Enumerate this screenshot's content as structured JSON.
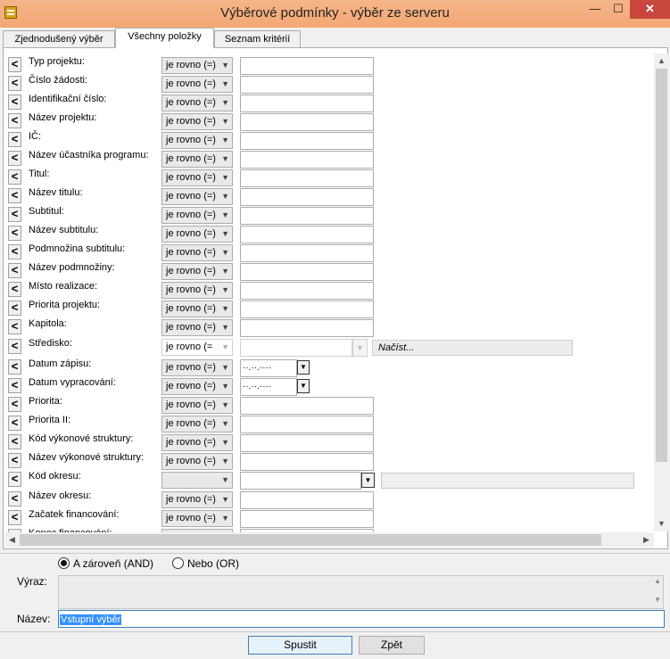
{
  "window": {
    "title": "Výběrové podmínky - výběr ze serveru",
    "minimize_glyph": "—",
    "maximize_glyph": "☐",
    "close_glyph": "✕",
    "icon": "app-icon"
  },
  "tabs": [
    {
      "label": "Zjednodušený výběr",
      "active": false
    },
    {
      "label": "Všechny položky",
      "active": true
    },
    {
      "label": "Seznam kritérií",
      "active": false
    }
  ],
  "criteria": [
    {
      "label": "Typ projektu:",
      "operator": "je rovno (=)",
      "kind": "text"
    },
    {
      "label": "Číslo žádosti:",
      "operator": "je rovno (=)",
      "kind": "text"
    },
    {
      "label": "Identifikační číslo:",
      "operator": "je rovno (=)",
      "kind": "text"
    },
    {
      "label": "Název projektu:",
      "operator": "je rovno (=)",
      "kind": "text"
    },
    {
      "label": "IČ:",
      "operator": "je rovno (=)",
      "kind": "text"
    },
    {
      "label": "Název účastníka programu:",
      "operator": "je rovno (=)",
      "kind": "text"
    },
    {
      "label": "Titul:",
      "operator": "je rovno (=)",
      "kind": "text"
    },
    {
      "label": "Název titulu:",
      "operator": "je rovno (=)",
      "kind": "text"
    },
    {
      "label": "Subtitul:",
      "operator": "je rovno (=)",
      "kind": "text"
    },
    {
      "label": "Název subtitulu:",
      "operator": "je rovno (=)",
      "kind": "text"
    },
    {
      "label": "Podmnožina subtitulu:",
      "operator": "je rovno (=)",
      "kind": "text"
    },
    {
      "label": "Název podmnožiny:",
      "operator": "je rovno (=)",
      "kind": "text"
    },
    {
      "label": "Místo realizace:",
      "operator": "je rovno (=)",
      "kind": "text"
    },
    {
      "label": "Priorita projektu:",
      "operator": "je rovno (=)",
      "kind": "text"
    },
    {
      "label": "Kapitola:",
      "operator": "je rovno (=)",
      "kind": "text"
    },
    {
      "label": "Středisko:",
      "operator": "je rovno (=",
      "kind": "lookup",
      "load_label": "Načíst..."
    },
    {
      "label": "Datum zápisu:",
      "operator": "je rovno (=)",
      "kind": "date",
      "value": "··.··.····"
    },
    {
      "label": "Datum vypracování:",
      "operator": "je rovno (=)",
      "kind": "date",
      "value": "··.··.····"
    },
    {
      "label": "Priorita:",
      "operator": "je rovno (=)",
      "kind": "text"
    },
    {
      "label": "Priorita II:",
      "operator": "je rovno (=)",
      "kind": "text"
    },
    {
      "label": "Kód výkonové struktury:",
      "operator": "je rovno (=)",
      "kind": "text"
    },
    {
      "label": "Název výkonové struktury:",
      "operator": "je rovno (=)",
      "kind": "text"
    },
    {
      "label": "Kód okresu:",
      "kind": "combo"
    },
    {
      "label": "Název okresu:",
      "operator": "je rovno (=)",
      "kind": "text"
    },
    {
      "label": "Začatek financování:",
      "operator": "je rovno (=)",
      "kind": "text"
    },
    {
      "label": "Konec financování:",
      "operator": "je rovno (=)",
      "kind": "text"
    }
  ],
  "row_button_glyph": "<",
  "combine": {
    "and_label": "A zároveň (AND)",
    "or_label": "Nebo (OR)",
    "selected": "AND"
  },
  "expression": {
    "label": "Výraz:",
    "value": ""
  },
  "name": {
    "label": "Název:",
    "value": "Vstupní výběr"
  },
  "buttons": {
    "run": "Spustit",
    "back": "Zpět"
  }
}
